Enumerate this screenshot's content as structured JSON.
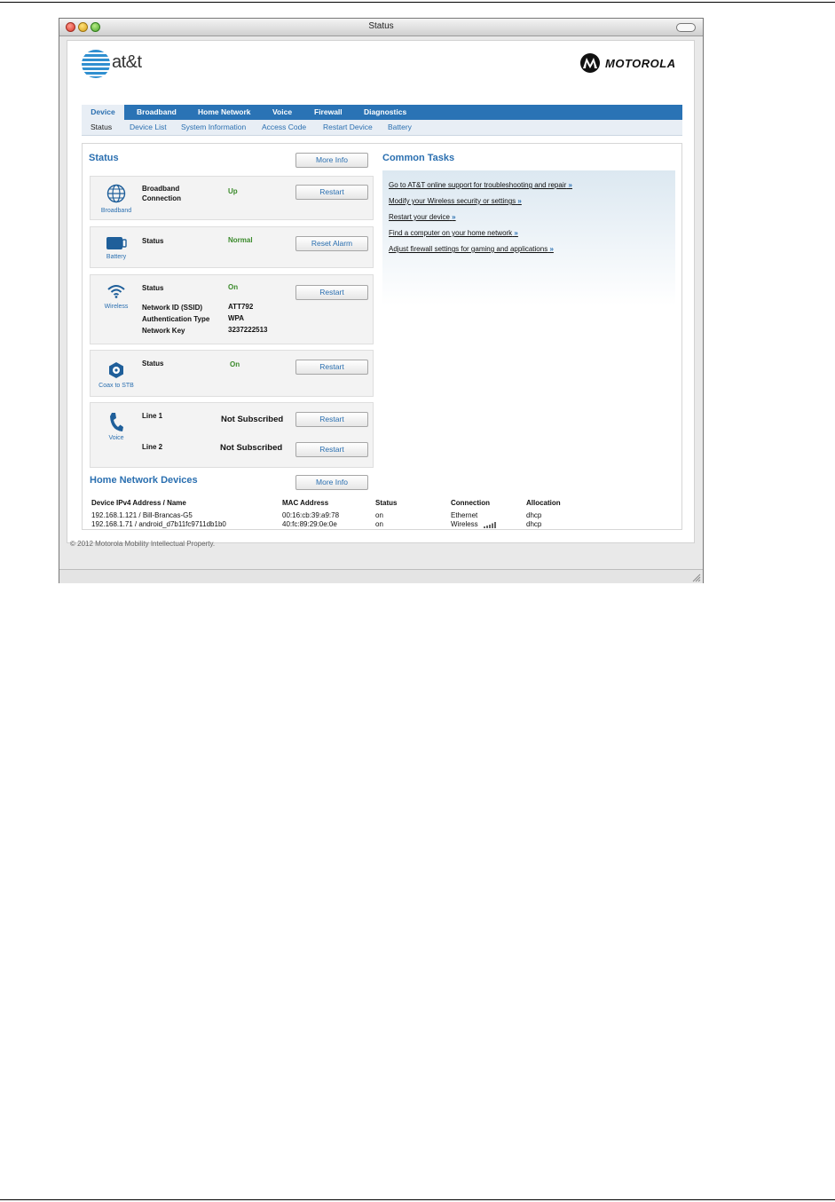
{
  "window": {
    "title": "Status"
  },
  "brand": {
    "att": "at&t",
    "motorola": "MOTOROLA"
  },
  "nav": {
    "tabs": [
      "Device",
      "Broadband",
      "Home Network",
      "Voice",
      "Firewall",
      "Diagnostics"
    ],
    "subtabs": [
      "Status",
      "Device List",
      "System Information",
      "Access Code",
      "Restart Device",
      "Battery"
    ]
  },
  "status": {
    "heading": "Status",
    "more_info": "More Info",
    "broadband": {
      "caption": "Broadband",
      "label": "Broadband\nConnection",
      "value": "Up",
      "button": "Restart"
    },
    "battery": {
      "caption": "Battery",
      "label": "Status",
      "value": "Normal",
      "button": "Reset Alarm"
    },
    "wireless": {
      "caption": "Wireless",
      "label": "Status",
      "value": "On",
      "button": "Restart",
      "ssid_label": "Network ID (SSID)",
      "ssid": "ATT792",
      "auth_label": "Authentication Type",
      "auth": "WPA",
      "key_label": "Network Key",
      "key": "3237222513"
    },
    "coax": {
      "caption": "Coax to STB",
      "label": "Status",
      "value": "On",
      "button": "Restart"
    },
    "voice": {
      "caption": "Voice",
      "line1_label": "Line 1",
      "line1_value": "Not Subscribed",
      "line1_button": "Restart",
      "line2_label": "Line 2",
      "line2_value": "Not Subscribed",
      "line2_button": "Restart"
    }
  },
  "common_tasks": {
    "heading": "Common Tasks",
    "links": [
      "Go to AT&T online support for troubleshooting and repair",
      "Modify your Wireless security or settings",
      "Restart your device",
      "Find a computer on your home network",
      "Adjust firewall settings for gaming and applications"
    ],
    "link_suffix": "»"
  },
  "home_network": {
    "heading": "Home Network Devices",
    "more_info": "More Info",
    "columns": [
      "Device IPv4 Address / Name",
      "MAC Address",
      "Status",
      "Connection",
      "Allocation"
    ],
    "rows": [
      [
        "192.168.1.121 / Bill-Brancas-G5",
        "00:16:cb:39:a9:78",
        "on",
        "Ethernet",
        "dhcp"
      ],
      [
        "192.168.1.71 /  android_d7b11fc9711db1b0",
        "40:fc:89:29:0e:0e",
        "on",
        "Wireless",
        "dhcp"
      ]
    ]
  },
  "footer": {
    "copyright": "© 2012 Motorola Mobility Intellectual Property."
  },
  "colors": {
    "accent": "#2a73b5",
    "link": "#2a6fb0",
    "ok": "#3a8a2a"
  }
}
